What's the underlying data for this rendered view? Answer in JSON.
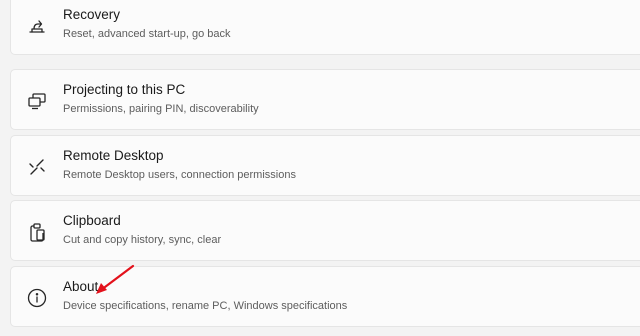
{
  "settings_list": {
    "items": [
      {
        "icon": "recovery-icon",
        "title": "Recovery",
        "subtitle": "Reset, advanced start-up, go back"
      },
      {
        "icon": "projecting-icon",
        "title": "Projecting to this PC",
        "subtitle": "Permissions, pairing PIN, discoverability"
      },
      {
        "icon": "remote-desktop-icon",
        "title": "Remote Desktop",
        "subtitle": "Remote Desktop users, connection permissions"
      },
      {
        "icon": "clipboard-icon",
        "title": "Clipboard",
        "subtitle": "Cut and copy history, sync, clear"
      },
      {
        "icon": "info-icon",
        "title": "About",
        "subtitle": "Device specifications, rename PC, Windows specifications"
      }
    ]
  },
  "annotation": {
    "arrow_color": "#e3111b",
    "points_to": "About"
  }
}
